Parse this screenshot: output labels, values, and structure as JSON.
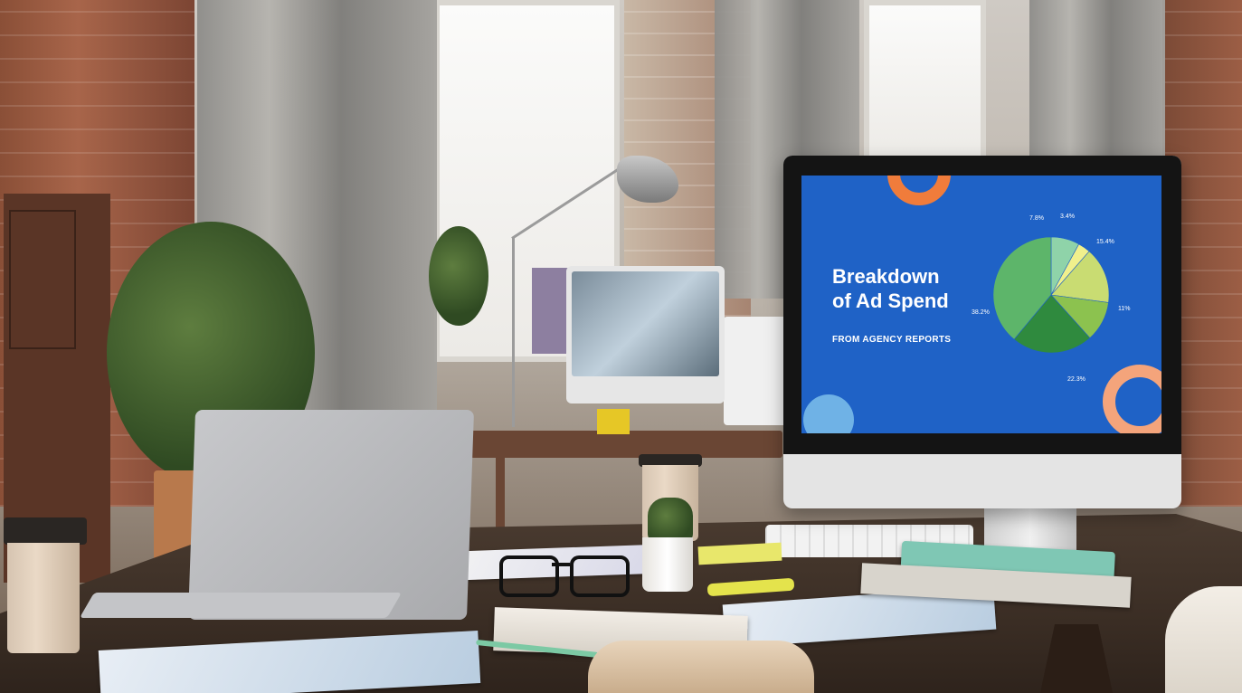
{
  "photo": {
    "monitor_screen": {
      "title_line1": "Breakdown",
      "title_line2": "of Ad Spend",
      "subtitle": "FROM AGENCY REPORTS",
      "background_color": "#1f62c6",
      "pie_percent_labels": [
        "7.8%",
        "3.4%",
        "15.4%",
        "11%",
        "22.3%",
        "38.2%"
      ],
      "pie_colors": [
        "#8fd3a9",
        "#f0f08c",
        "#c9dc72",
        "#8cc24f",
        "#2f8a3e",
        "#5db56a"
      ]
    },
    "accent_colors": {
      "orange_ring": "#f07c3b",
      "peach_ring": "#f4a47b",
      "light_blue_circle": "#6fb2e6"
    }
  }
}
